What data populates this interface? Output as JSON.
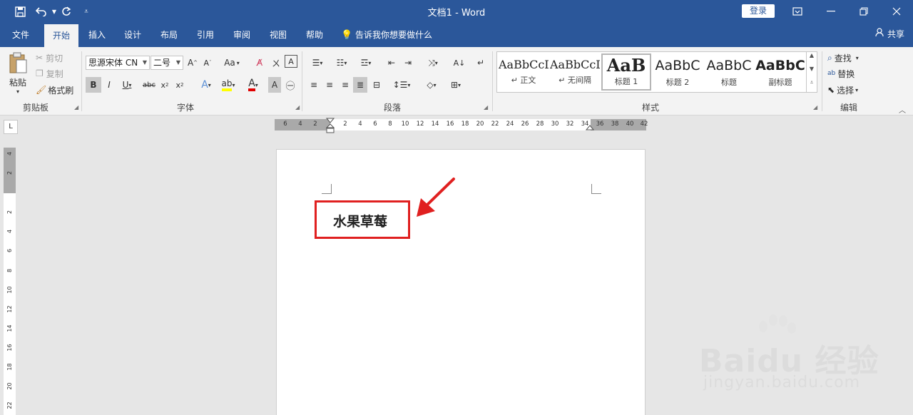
{
  "window": {
    "title": "文档1  -  Word",
    "login_label": "登录"
  },
  "tabs": [
    {
      "label": "文件"
    },
    {
      "label": "开始"
    },
    {
      "label": "插入"
    },
    {
      "label": "设计"
    },
    {
      "label": "布局"
    },
    {
      "label": "引用"
    },
    {
      "label": "审阅"
    },
    {
      "label": "视图"
    },
    {
      "label": "帮助"
    }
  ],
  "tellme": "告诉我你想要做什么",
  "share_label": "共享",
  "clipboard": {
    "paste": "粘贴",
    "cut": "剪切",
    "copy": "复制",
    "format_painter": "格式刷",
    "group": "剪贴板"
  },
  "font": {
    "name": "思源宋体 CN",
    "size": "二号",
    "group": "字体",
    "case": "Aa"
  },
  "paragraph": {
    "group": "段落"
  },
  "styles": {
    "group": "样式",
    "items": [
      {
        "sample": "AaBbCcDc",
        "name": "↵ 正文"
      },
      {
        "sample": "AaBbCcDc",
        "name": "↵ 无间隔"
      },
      {
        "sample": "AaB",
        "name": "标题 1"
      },
      {
        "sample": "AaBbC",
        "name": "标题 2"
      },
      {
        "sample": "AaBbC",
        "name": "标题"
      },
      {
        "sample": "AaBbC",
        "name": "副标题"
      }
    ]
  },
  "editing": {
    "find": "查找",
    "replace": "替换",
    "select": "选择",
    "group": "编辑"
  },
  "ruler": {
    "h_ticks": [
      "6",
      "4",
      "2",
      "2",
      "4",
      "6",
      "8",
      "10",
      "12",
      "14",
      "16",
      "18",
      "20",
      "22",
      "24",
      "26",
      "28",
      "30",
      "32",
      "34",
      "36",
      "38",
      "40",
      "42"
    ],
    "v_ticks": [
      "4",
      "2",
      "2",
      "4",
      "6",
      "8",
      "10",
      "12",
      "14",
      "16",
      "18",
      "20",
      "22"
    ]
  },
  "document": {
    "text": "水果草莓"
  },
  "watermark": {
    "brand": "Baidu 经验",
    "url": "jingyan.baidu.com"
  }
}
